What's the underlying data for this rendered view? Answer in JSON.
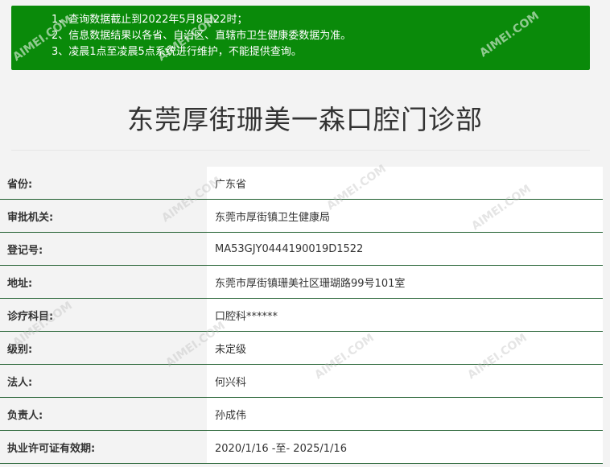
{
  "notice": {
    "lines": [
      "1、查询数据截止到2022年5月8日22时；",
      "2、信息数据结果以各省、自治区、直辖市卫生健康委数据为准。",
      "3、凌晨1点至凌晨5点系统进行维护，不能提供查询。"
    ]
  },
  "title": "东莞厚街珊美一森口腔门诊部",
  "rows": [
    {
      "label": "省份:",
      "value": "广东省"
    },
    {
      "label": "审批机关:",
      "value": "东莞市厚街镇卫生健康局"
    },
    {
      "label": "登记号:",
      "value": "MA53GJY0444190019D1522"
    },
    {
      "label": "地址:",
      "value": "东莞市厚街镇珊美社区珊瑚路99号101室"
    },
    {
      "label": "诊疗科目:",
      "value": "口腔科******"
    },
    {
      "label": "级别:",
      "value": "未定级"
    },
    {
      "label": "法人:",
      "value": "何兴科"
    },
    {
      "label": "负责人:",
      "value": "孙成伟"
    },
    {
      "label": "执业许可证有效期:",
      "value": "2020/1/16 -至- 2025/1/16"
    }
  ],
  "watermark": "AIMEI.COM"
}
